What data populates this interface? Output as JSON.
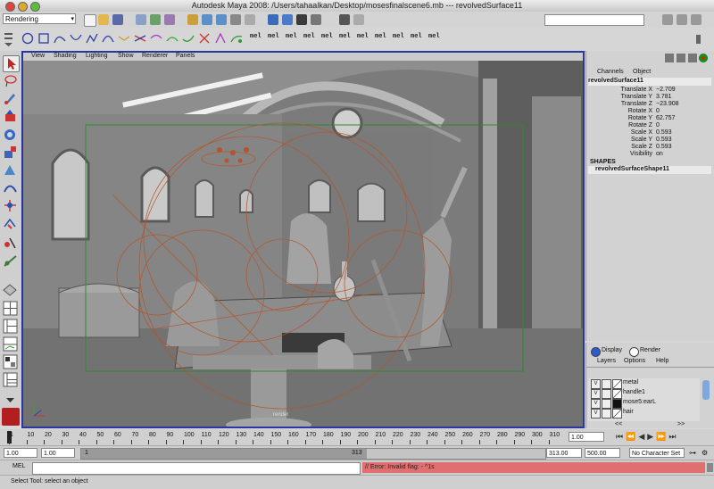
{
  "window": {
    "title": "Autodesk Maya 2008: /Users/tahaalkan/Desktop/mosesfinalscene6.mb  ---  revolvedSurface11"
  },
  "status_line": {
    "menu_set": "Rendering"
  },
  "shelf": {
    "mel_label": "mel"
  },
  "viewport": {
    "menu": [
      "View",
      "Shading",
      "Lighting",
      "Show",
      "Renderer",
      "Panels"
    ],
    "camera_label": "render"
  },
  "channel_box": {
    "tabs": [
      "Channels",
      "Object"
    ],
    "object_name": "revolvedSurface11",
    "attributes": [
      {
        "name": "Translate X",
        "value": "−2.709"
      },
      {
        "name": "Translate Y",
        "value": "3.781"
      },
      {
        "name": "Translate Z",
        "value": "−23.908"
      },
      {
        "name": "Rotate X",
        "value": "0"
      },
      {
        "name": "Rotate Y",
        "value": "62.757"
      },
      {
        "name": "Rotate Z",
        "value": "0"
      },
      {
        "name": "Scale X",
        "value": "0.593"
      },
      {
        "name": "Scale Y",
        "value": "0.593"
      },
      {
        "name": "Scale Z",
        "value": "0.593"
      },
      {
        "name": "Visibility",
        "value": "on"
      }
    ],
    "shapes_header": "SHAPES",
    "shape_name": "revolvedSurfaceShape11"
  },
  "layer_editor": {
    "modes": [
      "Display",
      "Render"
    ],
    "menu": [
      "Layers",
      "Options",
      "Help"
    ],
    "layers": [
      {
        "v": "V",
        "name": "metal"
      },
      {
        "v": "V",
        "name": "handle1"
      },
      {
        "v": "V",
        "name": "mose5:earL"
      },
      {
        "v": "V",
        "name": "hair"
      }
    ],
    "nav_left": "<<",
    "nav_right": ">>"
  },
  "time_slider": {
    "ticks": [
      "1",
      "10",
      "20",
      "30",
      "40",
      "50",
      "60",
      "70",
      "80",
      "90",
      "100",
      "110",
      "120",
      "130",
      "140",
      "150",
      "160",
      "170",
      "180",
      "190",
      "200",
      "210",
      "220",
      "230",
      "240",
      "250",
      "260",
      "270",
      "280",
      "290",
      "300",
      "310"
    ],
    "current_frame": "1.00"
  },
  "range_slider": {
    "start_time": "1.00",
    "playback_start": "1.00",
    "range_start_label": "1",
    "range_end_label": "313",
    "playback_end": "313.00",
    "end_time": "500.00",
    "character_set": "No Character Set"
  },
  "command_line": {
    "label": "MEL",
    "result": "// Error: Invalid flag: - ^1s"
  },
  "help_line": {
    "text": "Select Tool: select an object"
  },
  "colors": {
    "viewport_border": "#2a36a0",
    "error_bar": "#e07070",
    "selection_green": "#2e8b2e",
    "light_orange": "#b5542a"
  }
}
